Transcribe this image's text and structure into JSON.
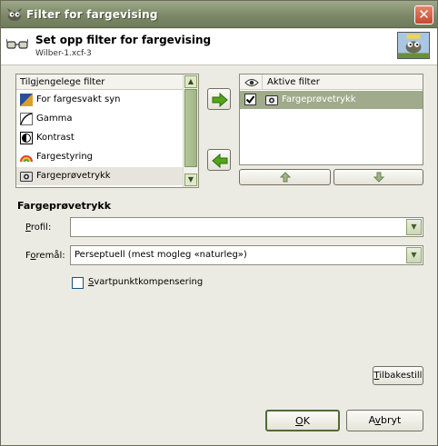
{
  "window": {
    "title": "Filter for fargevising",
    "close_glyph": "✕"
  },
  "header": {
    "title": "Set opp filter for fargevising",
    "subtitle": "Wilber-1.xcf-3"
  },
  "available": {
    "column_header": "Tilgjengelege filter",
    "items": [
      {
        "label": "For fargesvakt syn",
        "icon": "color-deficient-icon"
      },
      {
        "label": "Gamma",
        "icon": "gamma-icon"
      },
      {
        "label": "Kontrast",
        "icon": "contrast-icon"
      },
      {
        "label": "Fargestyring",
        "icon": "color-management-icon"
      },
      {
        "label": "Fargeprøvetrykk",
        "icon": "proof-icon"
      }
    ],
    "selected_index": 4
  },
  "active": {
    "eye_header_icon": "eye-icon",
    "column_header": "Aktive filter",
    "items": [
      {
        "label": "Fargeprøvetrykk",
        "enabled": true,
        "icon": "proof-icon"
      }
    ]
  },
  "buttons": {
    "add_icon": "arrow-right-icon",
    "remove_icon": "arrow-left-icon",
    "move_up_icon": "arrow-up-icon",
    "move_down_icon": "arrow-down-icon"
  },
  "settings": {
    "section_title": "Fargeprøvetrykk",
    "profile_label_u": "P",
    "profile_label_rest": "rofil:",
    "profile_value": "",
    "intent_label_pre": "F",
    "intent_label_u": "o",
    "intent_label_rest": "remål:",
    "intent_value": "Perseptuell (mest mogleg «naturleg»)",
    "bpc_label_u": "S",
    "bpc_label_rest": "vartpunktkompensering",
    "bpc_checked": false,
    "reset_label_u": "T",
    "reset_label_rest": "ilbakestill"
  },
  "footer": {
    "ok_label_u": "O",
    "ok_label_rest": "K",
    "cancel_label_pre": "A",
    "cancel_label_u": "v",
    "cancel_label_rest": "bryt"
  },
  "colors": {
    "selection": "#9fab8a",
    "accent_green": "#54a51b",
    "titlebar": "#7c8866"
  }
}
